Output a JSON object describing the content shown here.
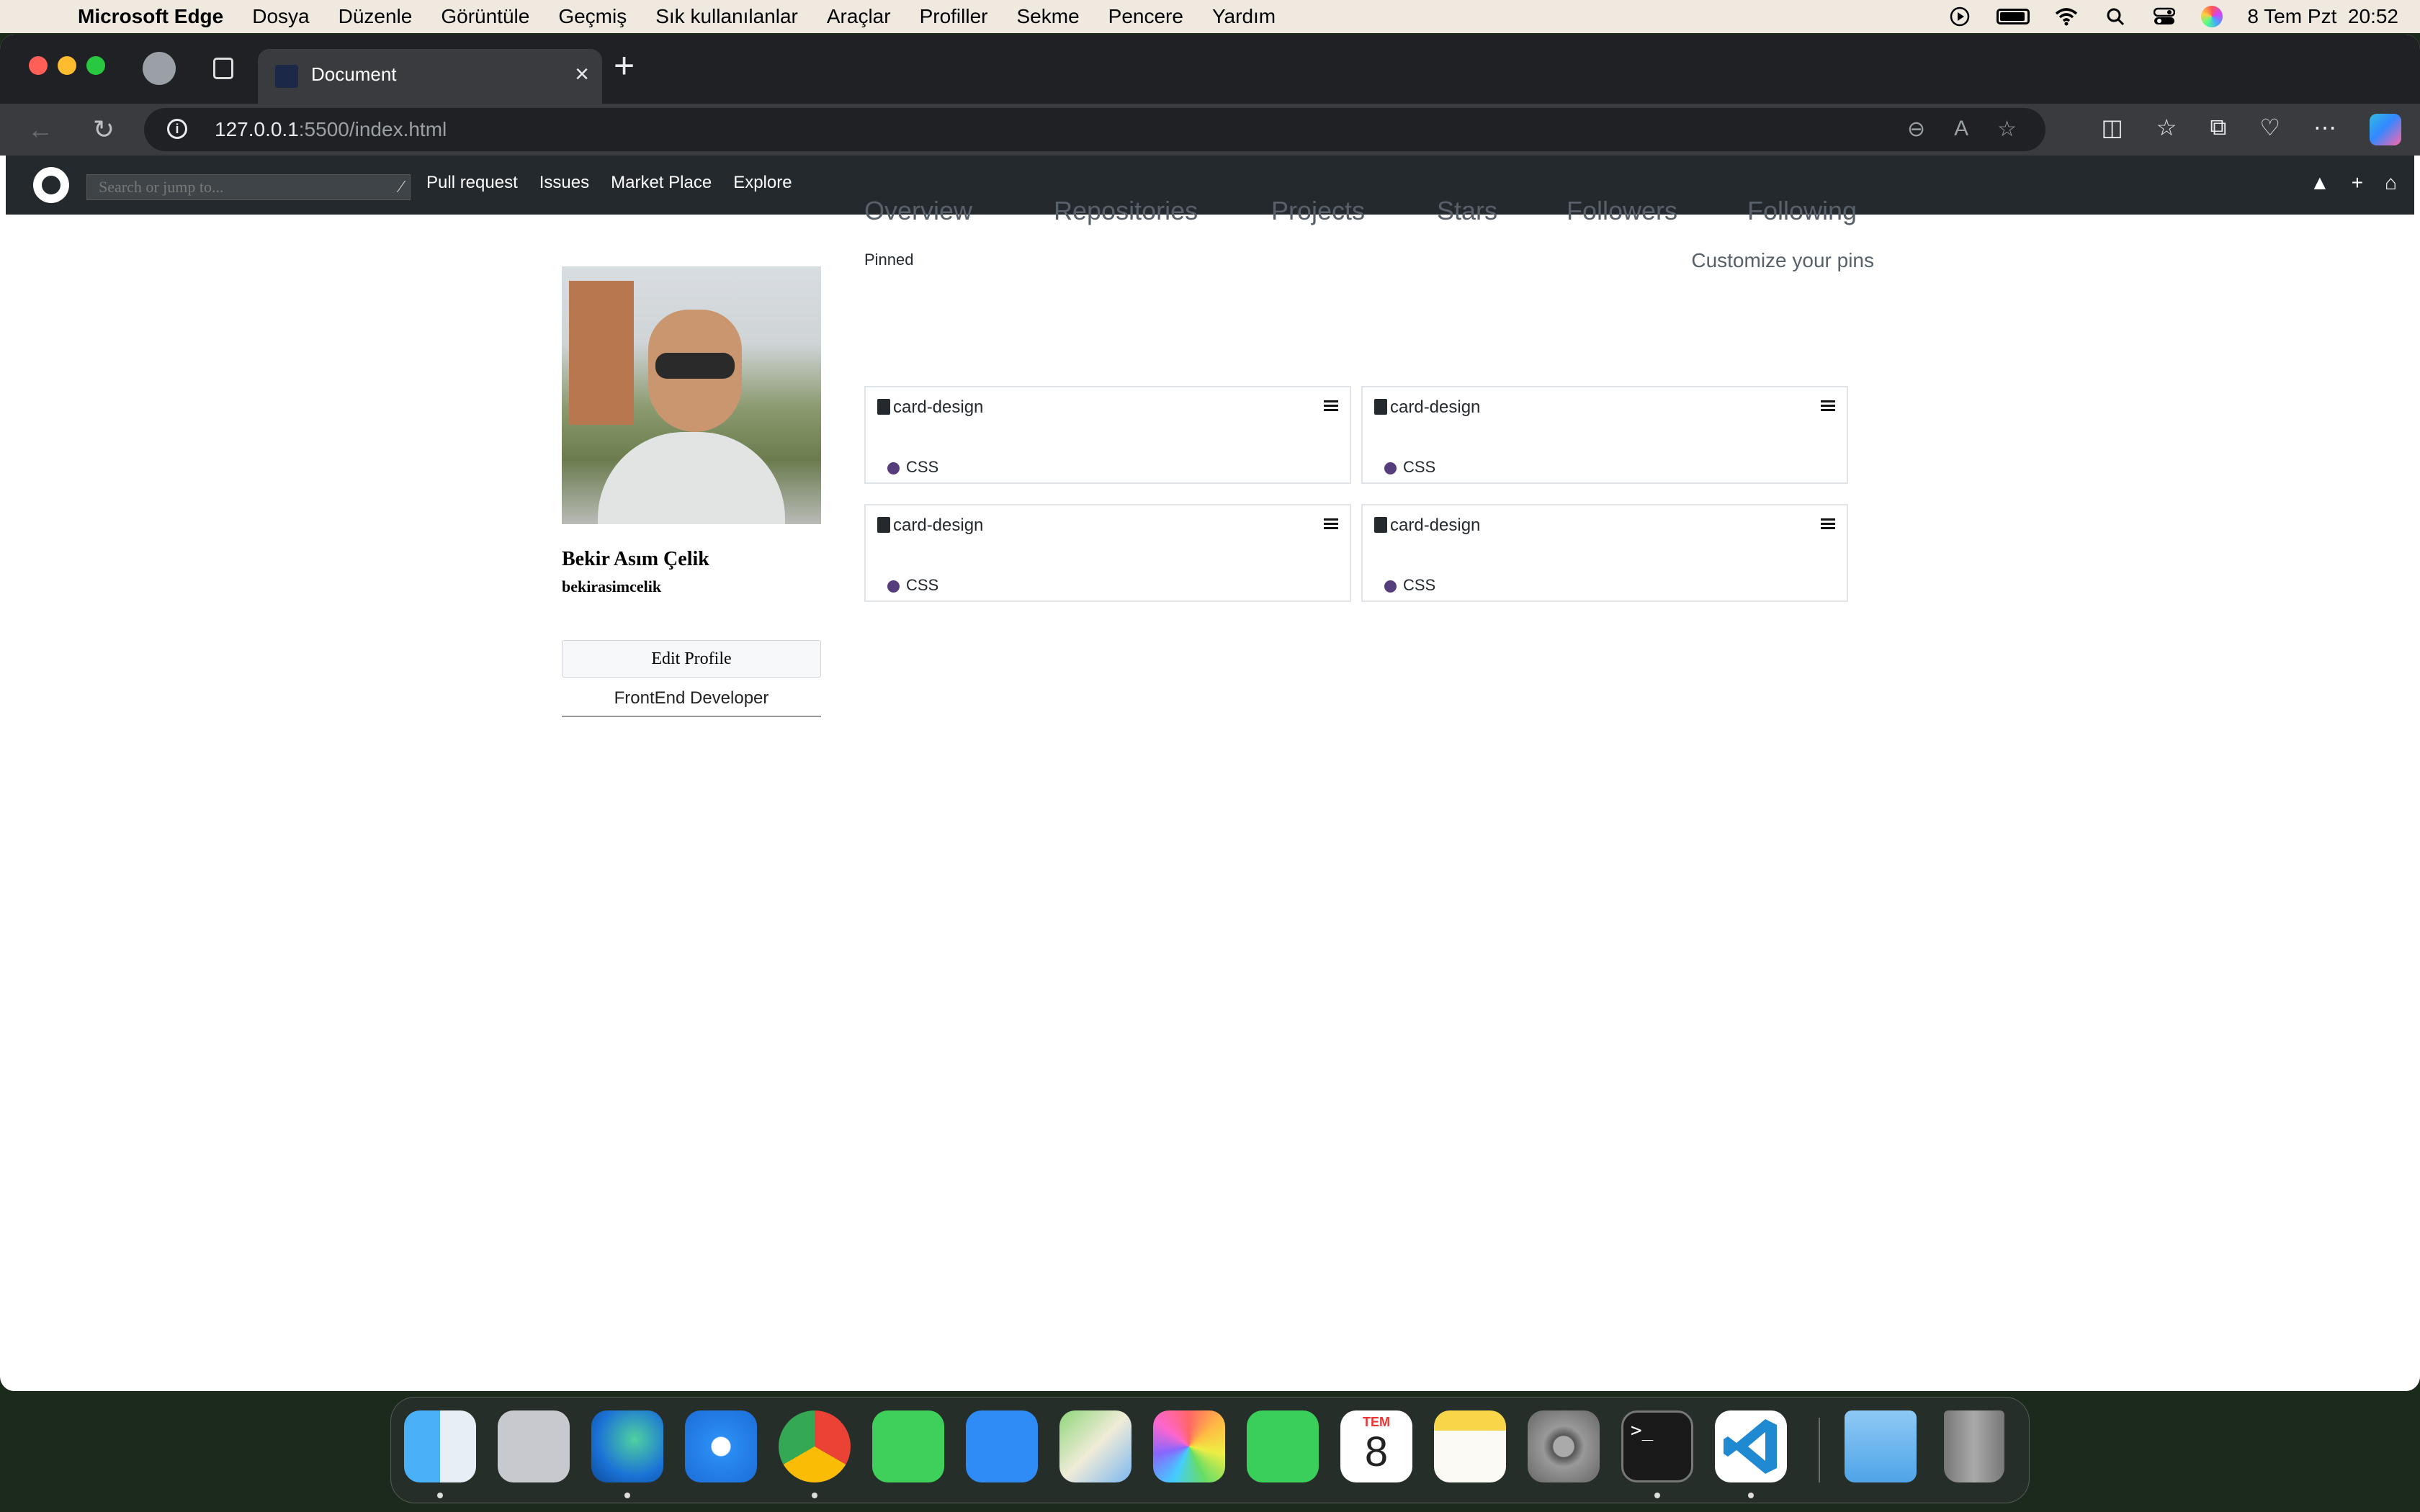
{
  "menubar": {
    "app_name": "Microsoft Edge",
    "items": [
      "Dosya",
      "Düzenle",
      "Görüntüle",
      "Geçmiş",
      "Sık kullanılanlar",
      "Araçlar",
      "Profiller",
      "Sekme",
      "Pencere",
      "Yardım"
    ],
    "datetime": "8 Tem Pzt  20:52",
    "status_icons": [
      "play-circle-icon",
      "battery-icon",
      "wifi-icon",
      "search-icon",
      "control-center-icon",
      "siri-icon"
    ]
  },
  "browser": {
    "tab_title": "Document",
    "url_host": "127.0.0.1",
    "url_path": ":5500/index.html"
  },
  "gh_header": {
    "search_placeholder": "Search or jump to...",
    "nav": [
      "Pull request",
      "Issues",
      "Market Place",
      "Explore"
    ],
    "right_icons": [
      "bell-icon",
      "plus-icon",
      "home-icon"
    ]
  },
  "profile": {
    "full_name": "Bekir Asım Çelik",
    "username": "bekirasimcelik",
    "edit_label": "Edit Profile",
    "bio": "FrontEnd Developer"
  },
  "main": {
    "tabs": [
      "Overview",
      "Repositories",
      "Projects",
      "Stars",
      "Followers",
      "Following"
    ],
    "pinned_label": "Pinned",
    "customize_label": "Customize your pins",
    "cards": [
      {
        "name": "card-design",
        "language": "CSS"
      },
      {
        "name": "card-design",
        "language": "CSS"
      },
      {
        "name": "card-design",
        "language": "CSS"
      },
      {
        "name": "card-design",
        "language": "CSS"
      }
    ],
    "language_color": "#563d7c"
  },
  "dock": {
    "apps": [
      "Finder",
      "Launchpad",
      "Microsoft Edge",
      "Safari",
      "Google Chrome",
      "Messages",
      "Mail",
      "Maps",
      "Photos",
      "FaceTime",
      "Calendar",
      "Notes",
      "System Settings",
      "Terminal",
      "Visual Studio Code",
      "Downloads",
      "Trash"
    ],
    "calendar_month": "TEM",
    "calendar_day": "8",
    "terminal_prompt": ">_"
  }
}
